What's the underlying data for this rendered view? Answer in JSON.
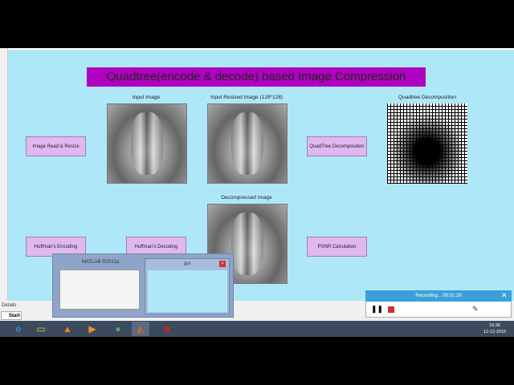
{
  "figure": {
    "title": "Quadtree(encode & decode) based Image Compression",
    "captions": {
      "input": "Input Image",
      "resized": "Input  Resized Image (128*128)",
      "quadtree": "Quadtree Decomposition",
      "decompressed": "Decompressed Image"
    },
    "buttons": {
      "read": "Image Read & Resize",
      "quadtree": "QuadTree Decomposition",
      "huff_enc": "Huffman's Encoding",
      "huff_dec": "Huffman's Decoding",
      "psnr": "PSNR Calculation"
    }
  },
  "details_label": "Details",
  "start_label": "Start",
  "switcher": {
    "matlab": "MATLAB  R2012a",
    "gui": "gui"
  },
  "recorder": {
    "status": "Recording... 00:01:26"
  },
  "clock": {
    "time": "16:36",
    "date": "12-12-2016"
  }
}
